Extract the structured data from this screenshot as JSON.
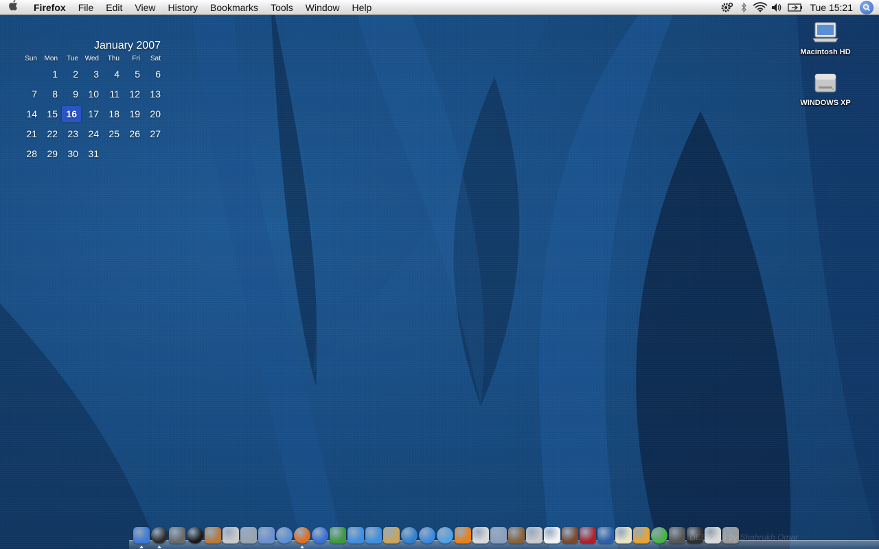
{
  "menubar": {
    "app_name": "Firefox",
    "items": [
      "File",
      "Edit",
      "View",
      "History",
      "Bookmarks",
      "Tools",
      "Window",
      "Help"
    ],
    "clock": "Tue 15:21",
    "status_icons": [
      "gear-icon",
      "bluetooth-icon",
      "wifi-icon",
      "volume-icon",
      "battery-icon"
    ]
  },
  "calendar": {
    "title": "January 2007",
    "weekdays": [
      "Sun",
      "Mon",
      "Tue",
      "Wed",
      "Thu",
      "Fri",
      "Sat"
    ],
    "weeks": [
      [
        "",
        "1",
        "2",
        "3",
        "4",
        "5",
        "6"
      ],
      [
        "7",
        "8",
        "9",
        "10",
        "11",
        "12",
        "13"
      ],
      [
        "14",
        "15",
        "16",
        "17",
        "18",
        "19",
        "20"
      ],
      [
        "21",
        "22",
        "23",
        "24",
        "25",
        "26",
        "27"
      ],
      [
        "28",
        "29",
        "30",
        "31",
        "",
        "",
        ""
      ]
    ],
    "today": "16"
  },
  "desktop_icons": [
    {
      "label": "Macintosh HD",
      "icon": "laptop-icon"
    },
    {
      "label": "WINDOWS XP",
      "icon": "hard-drive-icon"
    }
  ],
  "dock": {
    "watermark": "DESIGNS by Shahrukh Omar",
    "apps": [
      {
        "name": "finder-icon",
        "color": "#3d7bd9",
        "running": true
      },
      {
        "name": "dashboard-icon",
        "color": "#2b2b2b",
        "running": true
      },
      {
        "name": "expose-icon",
        "color": "#6a6a6a",
        "running": false
      },
      {
        "name": "camera-icon",
        "color": "#1a1a1a",
        "running": false
      },
      {
        "name": "coffee-icon",
        "color": "#b9793a",
        "running": false
      },
      {
        "name": "system-icon",
        "color": "#c9c9c9",
        "running": false
      },
      {
        "name": "editor-icon",
        "color": "#9aa3b0",
        "running": false
      },
      {
        "name": "preview-icon",
        "color": "#6b8fcf",
        "running": false
      },
      {
        "name": "safari-icon",
        "color": "#5b8fd6",
        "running": false
      },
      {
        "name": "firefox-icon",
        "color": "#e06d1e",
        "running": true
      },
      {
        "name": "compass-icon",
        "color": "#3b6fd1",
        "running": false
      },
      {
        "name": "buddy-icon",
        "color": "#3d9a3d",
        "running": false
      },
      {
        "name": "ichat-icon",
        "color": "#3f8ee0",
        "running": false
      },
      {
        "name": "messenger-icon",
        "color": "#3f8ee0",
        "running": false
      },
      {
        "name": "notepad-icon",
        "color": "#c9a45a",
        "running": false
      },
      {
        "name": "quicktime-icon",
        "color": "#2f7fd0",
        "running": false
      },
      {
        "name": "play-icon",
        "color": "#3c88e0",
        "running": false
      },
      {
        "name": "itunes-icon",
        "color": "#4ea1e6",
        "running": false
      },
      {
        "name": "vlc-icon",
        "color": "#e8811a",
        "running": false
      },
      {
        "name": "mplayer-icon",
        "color": "#d9d9d9",
        "running": false
      },
      {
        "name": "network-icon",
        "color": "#8a9fbd",
        "running": false
      },
      {
        "name": "photo-icon",
        "color": "#8a6238",
        "running": false
      },
      {
        "name": "mail-icon",
        "color": "#c9c9c9",
        "running": false
      },
      {
        "name": "ical-icon",
        "color": "#f1f1f1",
        "running": false
      },
      {
        "name": "tray-icon",
        "color": "#7b4a2a",
        "running": false
      },
      {
        "name": "book-icon",
        "color": "#b0222a",
        "running": false
      },
      {
        "name": "photoshop-icon",
        "color": "#2d5fa8",
        "running": false
      },
      {
        "name": "pencil-icon",
        "color": "#e8e3c2",
        "running": false
      },
      {
        "name": "script-icon",
        "color": "#e8a331",
        "running": false
      },
      {
        "name": "download-icon",
        "color": "#47b342",
        "running": false
      },
      {
        "name": "terminal-icon",
        "color": "#555555",
        "running": false
      },
      {
        "name": "font-icon",
        "color": "#2f2f2f",
        "running": false
      },
      {
        "name": "keyboard-icon",
        "color": "#d9d9d9",
        "running": false
      },
      {
        "name": "trash-icon",
        "color": "#9a9a9a",
        "running": false
      }
    ]
  }
}
